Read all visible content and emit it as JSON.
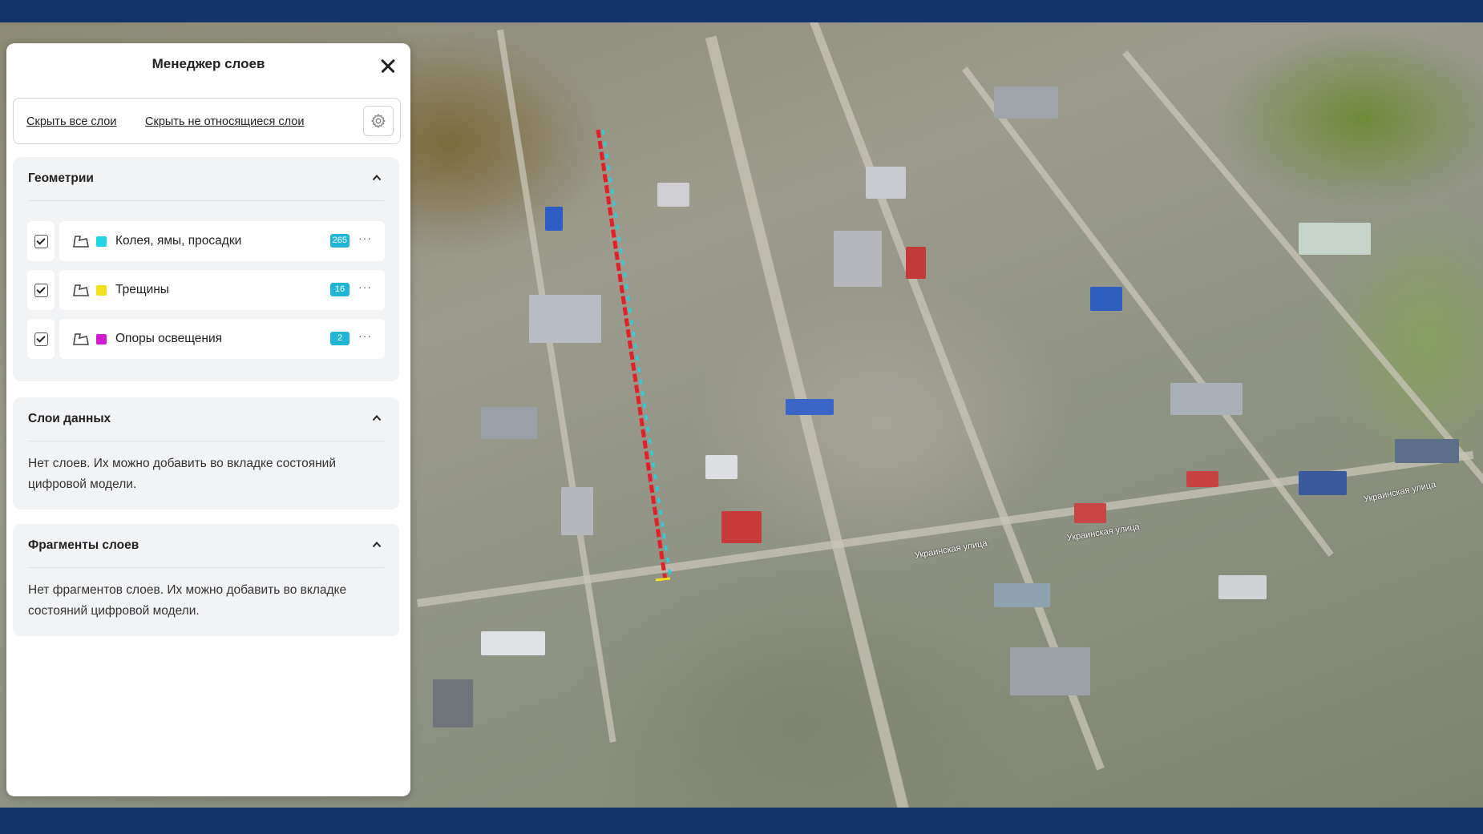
{
  "panel": {
    "title": "Менеджер слоев",
    "toolbar": {
      "hide_all": "Скрыть все слои",
      "hide_unrelated": "Скрыть не относящиеся слои"
    },
    "sections": {
      "geometry": {
        "title": "Геометрии",
        "layers": [
          {
            "label": "Колея, ямы, просадки",
            "count": "265",
            "color": "#22d3e6",
            "checked": true
          },
          {
            "label": "Трещины",
            "count": "16",
            "color": "#f2e21a",
            "checked": true
          },
          {
            "label": "Опоры освещения",
            "count": "2",
            "color": "#d41ad4",
            "checked": true
          }
        ]
      },
      "data_layers": {
        "title": "Слои данных",
        "empty_text": "Нет слоев. Их можно добавить во вкладке состояний цифровой модели."
      },
      "fragments": {
        "title": "Фрагменты слоев",
        "empty_text": "Нет фрагментов слоев. Их можно добавить во вкладке состояний цифровой модели."
      }
    }
  },
  "map": {
    "street_labels": [
      "Украинская улица",
      "Украинская улица",
      "Украинская улица"
    ],
    "route_colors": {
      "defects": "#e0202a",
      "cracks": "#22d3e6"
    }
  },
  "icons": {
    "close": "close-icon",
    "settings": "gear-icon",
    "section_toggle": "chevron-up-icon",
    "layer_type": "polygon-icon",
    "more": "more-dots-icon"
  }
}
